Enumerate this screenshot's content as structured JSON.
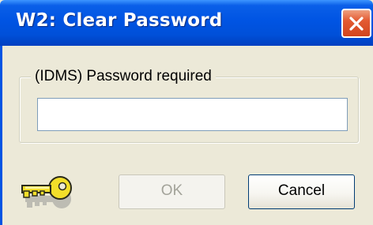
{
  "window": {
    "title": "W2: Clear Password",
    "close_icon": "close-icon"
  },
  "group": {
    "label": "(IDMS) Password required"
  },
  "password": {
    "value": "",
    "placeholder": ""
  },
  "icon": {
    "key": "key-icon"
  },
  "buttons": {
    "ok_label": "OK",
    "ok_enabled": false,
    "cancel_label": "Cancel"
  },
  "colors": {
    "titlebar": "#0054e3",
    "close_button": "#e35a32",
    "dialog_background": "#ece9d8",
    "key": "#f3df2a"
  }
}
